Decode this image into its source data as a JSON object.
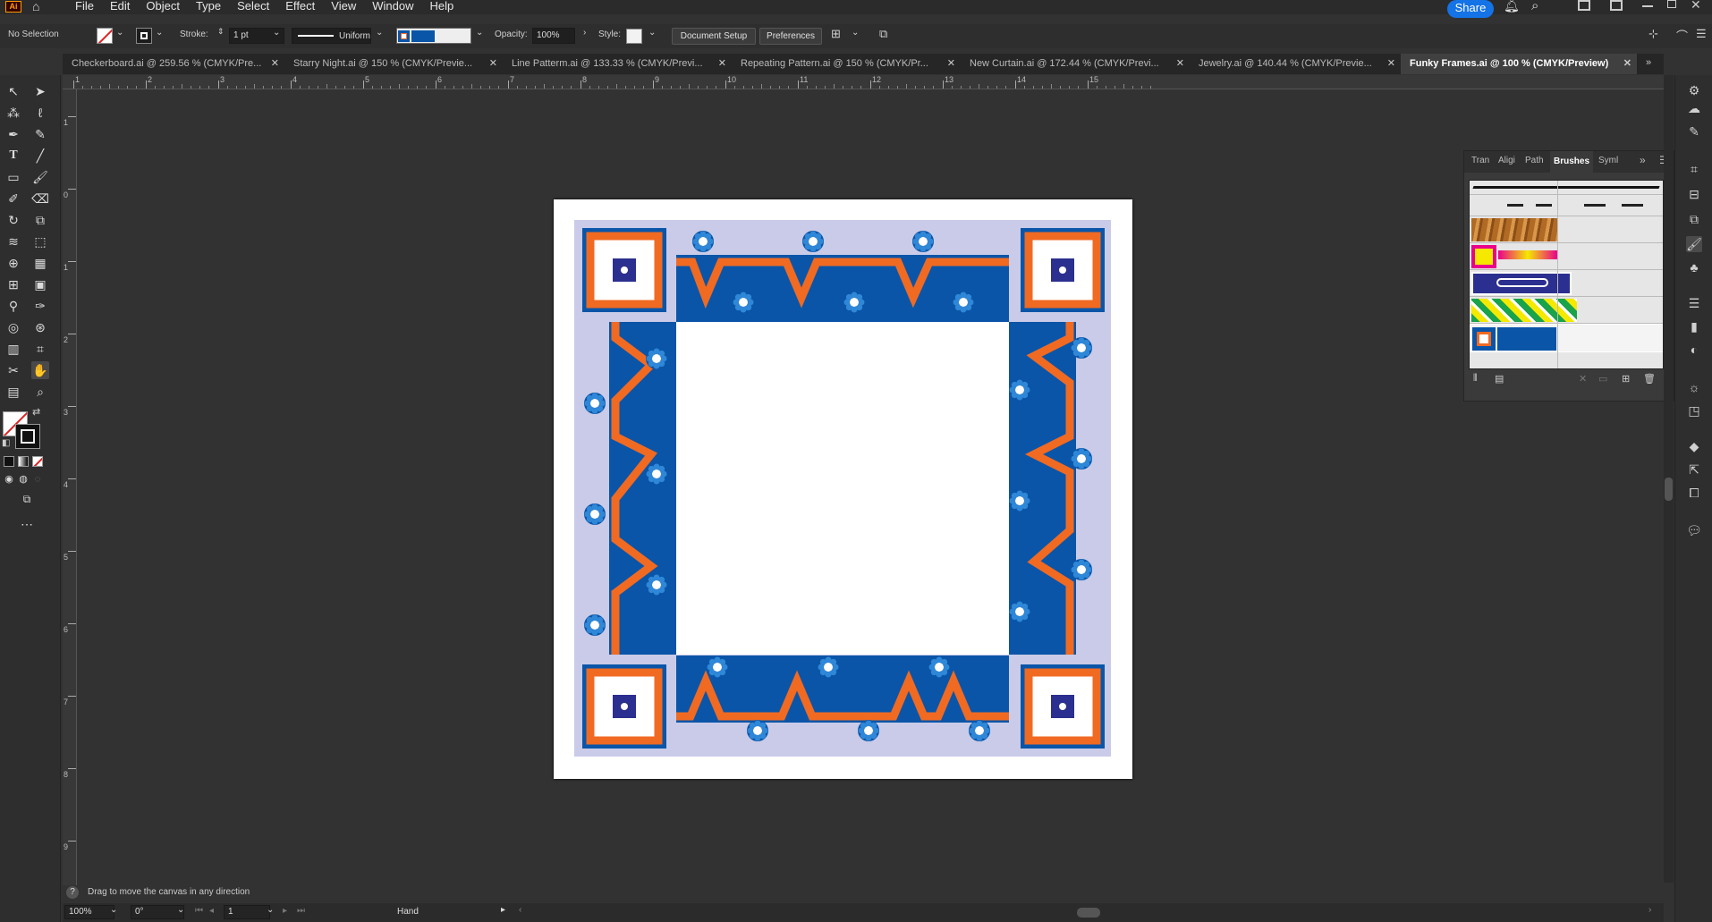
{
  "menubar": {
    "app_logo": "Ai",
    "items": [
      "File",
      "Edit",
      "Object",
      "Type",
      "Select",
      "Effect",
      "View",
      "Window",
      "Help"
    ],
    "share_label": "Share"
  },
  "control": {
    "selection_state": "No Selection",
    "stroke_label": "Stroke:",
    "stroke_value": "1 pt",
    "profile_value": "Uniform",
    "opacity_label": "Opacity:",
    "opacity_value": "100%",
    "style_label": "Style:",
    "doc_setup_label": "Document Setup",
    "preferences_label": "Preferences"
  },
  "tabs": [
    {
      "label": "Checkerboard.ai @ 259.56 % (CMYK/Pre...",
      "active": false
    },
    {
      "label": "Starry Night.ai @ 150 % (CMYK/Previe...",
      "active": false
    },
    {
      "label": "Line Patterm.ai @ 133.33 % (CMYK/Previ...",
      "active": false
    },
    {
      "label": "Repeating Pattern.ai @ 150 % (CMYK/Pr...",
      "active": false
    },
    {
      "label": "New Curtain.ai @ 172.44 % (CMYK/Previ...",
      "active": false
    },
    {
      "label": "Jewelry.ai @ 140.44 % (CMYK/Previe...",
      "active": false
    },
    {
      "label": "Funky Frames.ai @ 100 % (CMYK/Preview)",
      "active": true
    }
  ],
  "ruler_h": [
    "1",
    "2",
    "3",
    "4",
    "5",
    "6",
    "7",
    "8",
    "9",
    "10",
    "11",
    "12",
    "13",
    "14",
    "15"
  ],
  "ruler_v": [
    "1",
    "0",
    "1",
    "2",
    "3",
    "4",
    "5",
    "6",
    "7",
    "8",
    "9"
  ],
  "panel": {
    "tabs": [
      "Tran",
      "Aligi",
      "Path",
      "Brushes",
      "Syml"
    ],
    "active_tab": "Brushes"
  },
  "status": {
    "help_text": "Drag to move the canvas in any direction",
    "zoom": "100%",
    "rotation": "0°",
    "artboard_num": "1",
    "tool_name": "Hand"
  },
  "colors": {
    "frame_blue": "#0a55a8",
    "frame_orange": "#f06a22",
    "frame_lavender": "#c9cbe8",
    "center_navy": "#2b2f8f",
    "accent": "#1473e6"
  }
}
